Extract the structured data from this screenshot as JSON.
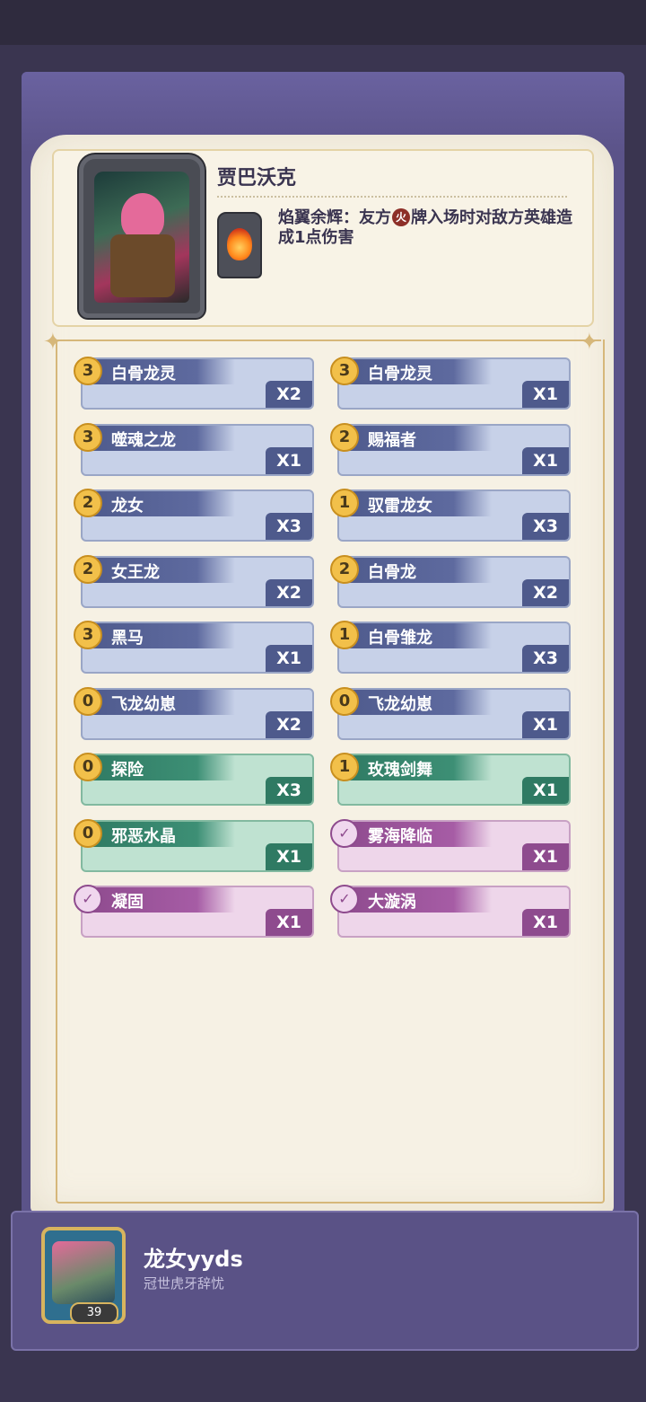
{
  "hero": {
    "name": "贾巴沃克",
    "skill_prefix": "焰翼余辉：友方",
    "skill_badge": "火",
    "skill_suffix": "牌入场时对敌方英雄造成1点伤害"
  },
  "cards": [
    {
      "cost": "3",
      "name": "白骨龙灵",
      "qty": "X2",
      "style": "blue"
    },
    {
      "cost": "3",
      "name": "白骨龙灵",
      "qty": "X1",
      "style": "blue"
    },
    {
      "cost": "3",
      "name": "噬魂之龙",
      "qty": "X1",
      "style": "blue"
    },
    {
      "cost": "2",
      "name": "赐福者",
      "qty": "X1",
      "style": "blue"
    },
    {
      "cost": "2",
      "name": "龙女",
      "qty": "X3",
      "style": "blue"
    },
    {
      "cost": "1",
      "name": "驭雷龙女",
      "qty": "X3",
      "style": "blue"
    },
    {
      "cost": "2",
      "name": "女王龙",
      "qty": "X2",
      "style": "blue"
    },
    {
      "cost": "2",
      "name": "白骨龙",
      "qty": "X2",
      "style": "blue"
    },
    {
      "cost": "3",
      "name": "黑马",
      "qty": "X1",
      "style": "blue"
    },
    {
      "cost": "1",
      "name": "白骨雏龙",
      "qty": "X3",
      "style": "blue"
    },
    {
      "cost": "0",
      "name": "飞龙幼崽",
      "qty": "X2",
      "style": "blue"
    },
    {
      "cost": "0",
      "name": "飞龙幼崽",
      "qty": "X1",
      "style": "blue"
    },
    {
      "cost": "0",
      "name": "探险",
      "qty": "X3",
      "style": "green"
    },
    {
      "cost": "1",
      "name": "玫瑰剑舞",
      "qty": "X1",
      "style": "green"
    },
    {
      "cost": "0",
      "name": "邪恶水晶",
      "qty": "X1",
      "style": "green"
    },
    {
      "cost": "✓",
      "name": "雾海降临",
      "qty": "X1",
      "style": "pink"
    },
    {
      "cost": "✓",
      "name": "凝固",
      "qty": "X1",
      "style": "pink"
    },
    {
      "cost": "✓",
      "name": "大漩涡",
      "qty": "X1",
      "style": "pink"
    }
  ],
  "player": {
    "name": "龙女yyds",
    "title": "冠世虎牙辞忧",
    "level": "39"
  },
  "colors": {
    "frame": "#5b5389",
    "paper": "#f6f1e4",
    "card_blue": "#4e5a8c",
    "card_green": "#2f7a63",
    "card_pink": "#8e4b8e",
    "cost_gold": "#f2c04a"
  }
}
